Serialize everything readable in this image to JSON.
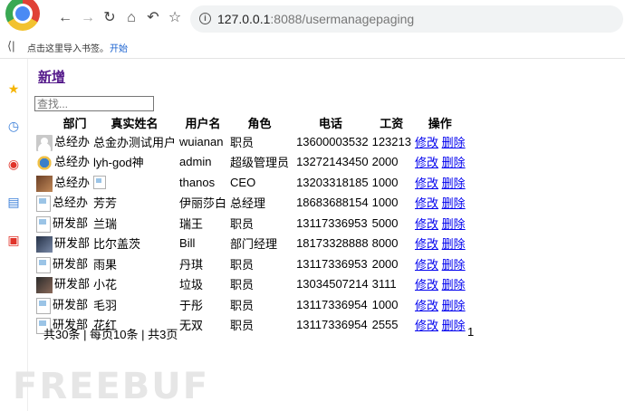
{
  "browser": {
    "url_host": "127.0.0.1",
    "url_rest": ":8088/usermanagepaging",
    "bookmark_hint": "点击这里导入书签。",
    "bookmark_start": "开始",
    "icons": [
      "back-icon",
      "forward-icon",
      "reload-icon",
      "home-icon",
      "undo-icon",
      "star-icon",
      "info-icon"
    ]
  },
  "sidebar": {
    "icons": [
      "favorites-star-icon",
      "history-icon",
      "weibo-icon",
      "tabs-icon",
      "pdf-icon"
    ]
  },
  "page": {
    "add_label": "新增",
    "search_placeholder": "查找...",
    "columns": [
      "部门",
      "真实姓名",
      "用户名",
      "角色",
      "电话",
      "工资",
      "操作"
    ],
    "rows": [
      {
        "dept": "总经办",
        "name": "总金办测试用户",
        "username": "wuianan",
        "role": "职员",
        "phone": "13600003532",
        "salary": "123213",
        "avatar": "gray"
      },
      {
        "dept": "总经办",
        "name": "lyh-god神",
        "username": "admin",
        "role": "超级管理员",
        "phone": "13272143450",
        "salary": "2000",
        "avatar": "blue"
      },
      {
        "dept": "总经办",
        "name": "",
        "username": "thanos",
        "role": "CEO",
        "phone": "13203318185",
        "salary": "1000",
        "avatar": "photo1",
        "name_broken_img": true
      },
      {
        "dept": "总经办",
        "name": "芳芳",
        "username": "伊丽莎白",
        "role": "总经理",
        "phone": "18683688154",
        "salary": "1000",
        "avatar": "broken"
      },
      {
        "dept": "研发部",
        "name": "兰瑞",
        "username": "瑞王",
        "role": "职员",
        "phone": "13117336953",
        "salary": "5000",
        "avatar": "broken"
      },
      {
        "dept": "研发部",
        "name": "比尔盖茨",
        "username": "Bill",
        "role": "部门经理",
        "phone": "18173328888",
        "salary": "8000",
        "avatar": "photo2"
      },
      {
        "dept": "研发部",
        "name": "雨果",
        "username": "丹琪",
        "role": "职员",
        "phone": "13117336953",
        "salary": "2000",
        "avatar": "broken"
      },
      {
        "dept": "研发部",
        "name": "小花",
        "username": "垃圾",
        "role": "职员",
        "phone": "13034507214",
        "salary": "3111",
        "avatar": "photo3"
      },
      {
        "dept": "研发部",
        "name": "毛羽",
        "username": "于彤",
        "role": "职员",
        "phone": "13117336954",
        "salary": "1000",
        "avatar": "broken"
      },
      {
        "dept": "研发部",
        "name": "花红",
        "username": "无双",
        "role": "职员",
        "phone": "13117336954",
        "salary": "2555",
        "avatar": "broken"
      }
    ],
    "actions": {
      "edit": "修改",
      "delete": "删除"
    },
    "pager_text": "共30条 | 每页10条 | 共3页",
    "page_number": "1"
  },
  "watermark": "FREEBUF"
}
